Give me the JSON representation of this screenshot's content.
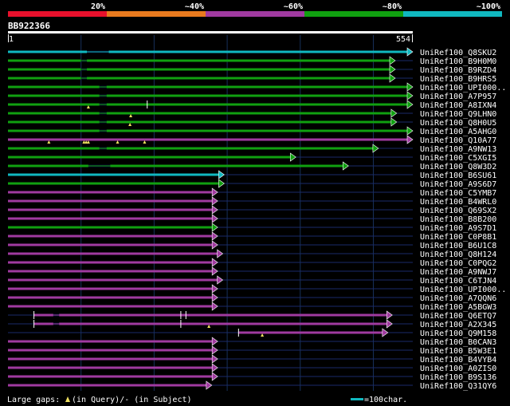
{
  "legend_percent": {
    "labels": [
      "20%",
      "~40%",
      "~60%",
      "~80%",
      "~100%"
    ],
    "colors": [
      "#e8102c",
      "#e87a1e",
      "#a03aa0",
      "#10a010",
      "#10b8c0"
    ]
  },
  "query": {
    "id": "BB922366",
    "start": "1",
    "end": "554",
    "length": 554
  },
  "colors": {
    "cyan": "#10b8c0",
    "green": "#10a010",
    "magenta": "#a03aa0",
    "track": "#1a2a6a",
    "grid": "#16305a",
    "arrow_outline": "#ffffff"
  },
  "hits": [
    {
      "label": "UniRef100_Q8SKU2",
      "color": "cyan",
      "start": 0,
      "end": 554,
      "gaps": [
        108,
        138
      ]
    },
    {
      "label": "UniRef100_B9H0M0",
      "color": "green",
      "start": 0,
      "end": 530,
      "gaps": [
        100,
        108
      ]
    },
    {
      "label": "UniRef100_B9RZD4",
      "color": "green",
      "start": 0,
      "end": 530,
      "gaps": [
        100,
        108
      ]
    },
    {
      "label": "UniRef100_B9HRS5",
      "color": "green",
      "start": 0,
      "end": 530,
      "gaps": [
        100,
        108
      ]
    },
    {
      "label": "UniRef100_UPI000..",
      "color": "green",
      "start": 0,
      "end": 554,
      "gaps": [
        125,
        135
      ]
    },
    {
      "label": "UniRef100_A7P957",
      "color": "green",
      "start": 0,
      "end": 554,
      "gaps": [
        125,
        135
      ]
    },
    {
      "label": "UniRef100_A8IXN4",
      "color": "green",
      "start": 0,
      "end": 554,
      "gaps": [
        125,
        135
      ],
      "tri": [
        110
      ],
      "bars": [
        190
      ]
    },
    {
      "label": "UniRef100_Q9LHN0",
      "color": "green",
      "start": 0,
      "end": 532,
      "gaps": [
        125,
        135
      ],
      "tri": [
        168
      ]
    },
    {
      "label": "UniRef100_Q8H0U5",
      "color": "green",
      "start": 0,
      "end": 532,
      "gaps": [
        125,
        135
      ],
      "tri": [
        167
      ]
    },
    {
      "label": "UniRef100_A5AHG0",
      "color": "green",
      "start": 0,
      "end": 554,
      "gaps": [
        125,
        135
      ]
    },
    {
      "label": "UniRef100_Q10A77",
      "color": "magenta",
      "start": 0,
      "end": 554,
      "gaps": [],
      "tri": [
        56,
        104,
        107,
        110,
        150,
        187
      ]
    },
    {
      "label": "UniRef100_A9NW13",
      "color": "green",
      "start": 0,
      "end": 507,
      "gaps": [
        125,
        135
      ]
    },
    {
      "label": "UniRef100_C5XGI5",
      "color": "green",
      "start": 0,
      "end": 394,
      "gaps": []
    },
    {
      "label": "UniRef100_Q8W3D2",
      "color": "green",
      "start": 0,
      "end": 466,
      "gaps": [
        110,
        140
      ]
    },
    {
      "label": "UniRef100_B6SU61",
      "color": "cyan",
      "start": 0,
      "end": 296,
      "gaps": []
    },
    {
      "label": "UniRef100_A9S6D7",
      "color": "green",
      "start": 0,
      "end": 296,
      "gaps": []
    },
    {
      "label": "UniRef100_C5YMB7",
      "color": "magenta",
      "start": 0,
      "end": 287,
      "gaps": []
    },
    {
      "label": "UniRef100_B4WRL0",
      "color": "magenta",
      "start": 0,
      "end": 287,
      "gaps": []
    },
    {
      "label": "UniRef100_Q69SX2",
      "color": "magenta",
      "start": 0,
      "end": 287,
      "gaps": []
    },
    {
      "label": "UniRef100_B8B200",
      "color": "magenta",
      "start": 0,
      "end": 287,
      "gaps": []
    },
    {
      "label": "UniRef100_A9S7D1",
      "color": "green",
      "start": 0,
      "end": 287,
      "gaps": []
    },
    {
      "label": "UniRef100_C0P8B1",
      "color": "magenta",
      "start": 0,
      "end": 287,
      "gaps": []
    },
    {
      "label": "UniRef100_B6U1C8",
      "color": "magenta",
      "start": 0,
      "end": 287,
      "gaps": []
    },
    {
      "label": "UniRef100_Q8H124",
      "color": "magenta",
      "start": 0,
      "end": 294,
      "gaps": []
    },
    {
      "label": "UniRef100_C0PQG2",
      "color": "magenta",
      "start": 0,
      "end": 287,
      "gaps": []
    },
    {
      "label": "UniRef100_A9NWJ7",
      "color": "magenta",
      "start": 0,
      "end": 287,
      "gaps": []
    },
    {
      "label": "UniRef100_C6TJN4",
      "color": "magenta",
      "start": 0,
      "end": 294,
      "gaps": []
    },
    {
      "label": "UniRef100_UPI000..",
      "color": "magenta",
      "start": 0,
      "end": 287,
      "gaps": []
    },
    {
      "label": "UniRef100_A7QQN6",
      "color": "magenta",
      "start": 0,
      "end": 287,
      "gaps": []
    },
    {
      "label": "UniRef100_A5BGW3",
      "color": "magenta",
      "start": 0,
      "end": 287,
      "gaps": []
    },
    {
      "label": "UniRef100_Q6ETQ7",
      "color": "magenta",
      "start": 35,
      "end": 526,
      "gaps": [
        62,
        70
      ],
      "bars": [
        35,
        236,
        243
      ]
    },
    {
      "label": "UniRef100_A2X345",
      "color": "magenta",
      "start": 35,
      "end": 526,
      "gaps": [
        62,
        70
      ],
      "tri": [
        275
      ],
      "bars": [
        35,
        236
      ]
    },
    {
      "label": "UniRef100_Q9M158",
      "color": "magenta",
      "start": 315,
      "end": 520,
      "gaps": [],
      "tri": [
        348
      ],
      "bars": [
        315
      ]
    },
    {
      "label": "UniRef100_B0CAN3",
      "color": "magenta",
      "start": 0,
      "end": 287,
      "gaps": []
    },
    {
      "label": "UniRef100_B5W3E1",
      "color": "magenta",
      "start": 0,
      "end": 287,
      "gaps": []
    },
    {
      "label": "UniRef100_B4VYB4",
      "color": "magenta",
      "start": 0,
      "end": 287,
      "gaps": []
    },
    {
      "label": "UniRef100_A0ZIS0",
      "color": "magenta",
      "start": 0,
      "end": 287,
      "gaps": []
    },
    {
      "label": "UniRef100_B9S136",
      "color": "magenta",
      "start": 0,
      "end": 287,
      "gaps": []
    },
    {
      "label": "UniRef100_Q31QY6",
      "color": "magenta",
      "start": 0,
      "end": 279,
      "gaps": []
    }
  ],
  "footer": {
    "gaps_prefix": "Large gaps: ",
    "gaps_query_text": "(in Query)/- (in Subject)",
    "scale_text": "=100char."
  }
}
